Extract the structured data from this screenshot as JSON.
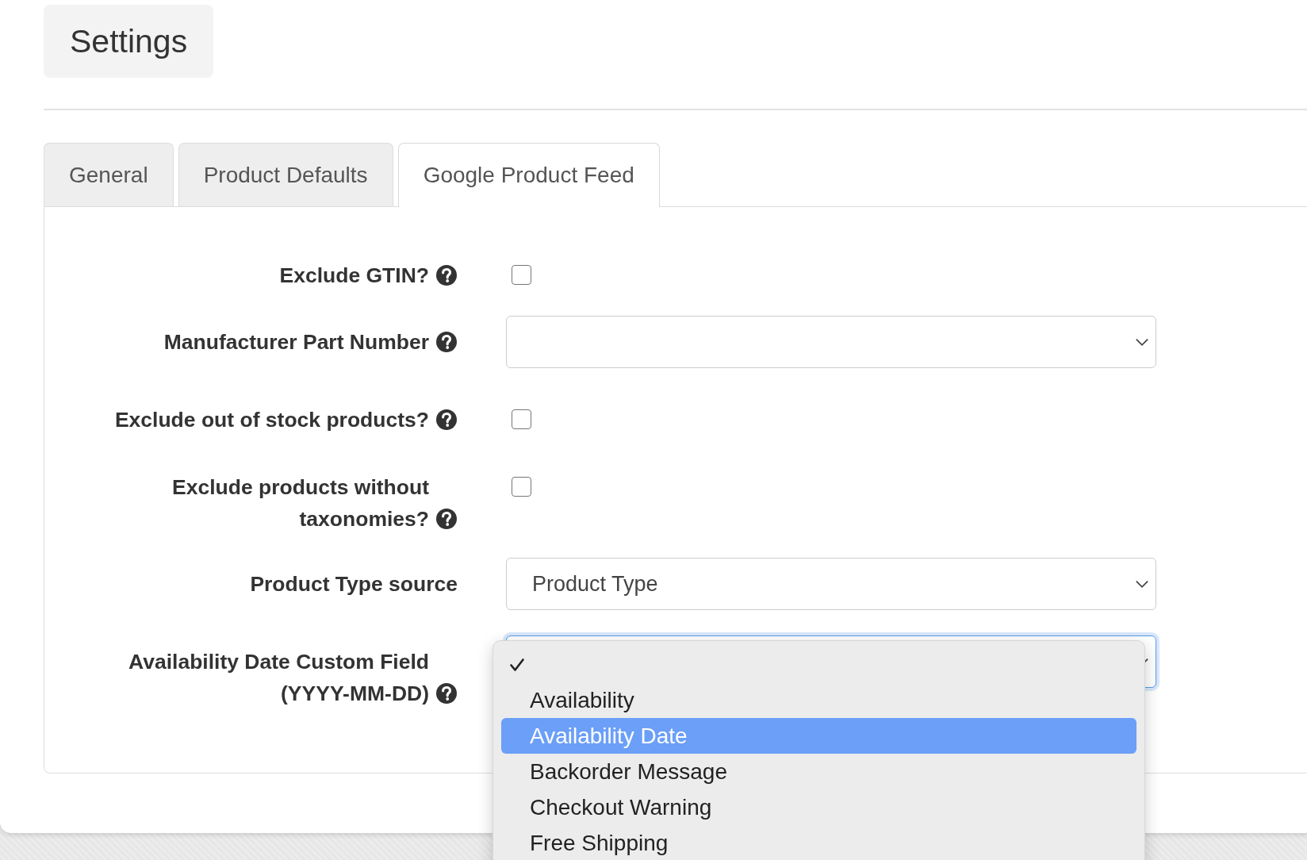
{
  "heading": "Settings",
  "tabs": [
    {
      "label": "General",
      "selected": false
    },
    {
      "label": "Product Defaults",
      "selected": false
    },
    {
      "label": "Google Product Feed",
      "selected": true
    }
  ],
  "fields": [
    {
      "kind": "checkbox",
      "label": "Exclude GTIN?",
      "help": true,
      "checked": false
    },
    {
      "kind": "select",
      "label": "Manufacturer Part Number",
      "help": true,
      "focused": false
    },
    {
      "kind": "checkbox",
      "label": "Exclude out of stock products?",
      "help": true,
      "checked": false
    },
    {
      "kind": "checkbox",
      "label": "Exclude products without taxonomies?",
      "help": true,
      "checked": false
    },
    {
      "kind": "select",
      "label": "Product Type source",
      "help": false,
      "value": "Product Type",
      "focused": false
    },
    {
      "kind": "select",
      "label": "Availability Date Custom Field (YYYY-MM-DD)",
      "help": true,
      "focused": true,
      "dropdown": {
        "options": [
          {
            "checked": true,
            "highlighted": false
          },
          {
            "label": "Availability",
            "checked": false,
            "highlighted": false
          },
          {
            "label": "Availability Date",
            "checked": false,
            "highlighted": true
          },
          {
            "label": "Backorder Message",
            "checked": false,
            "highlighted": false
          },
          {
            "label": "Checkout Warning",
            "checked": false,
            "highlighted": false
          },
          {
            "label": "Free Shipping",
            "checked": false,
            "highlighted": false
          }
        ]
      }
    }
  ]
}
